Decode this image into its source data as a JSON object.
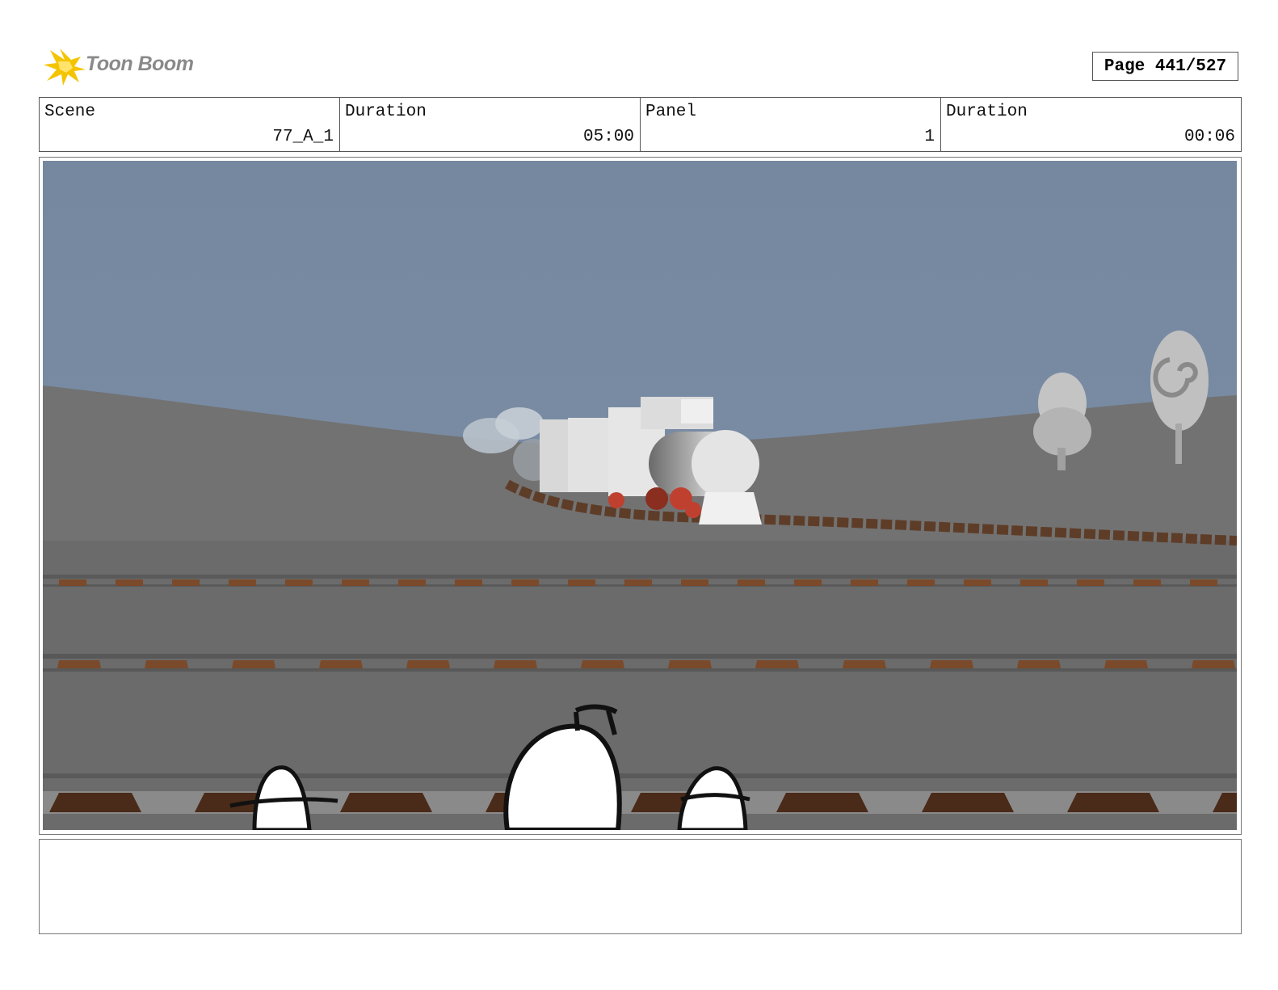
{
  "header": {
    "logo_text": "Toon Boom",
    "page_label": "Page 441/527"
  },
  "info": {
    "scene_label": "Scene",
    "scene_value": "77_A_1",
    "scene_duration_label": "Duration",
    "scene_duration_value": "05:00",
    "panel_label": "Panel",
    "panel_value": "1",
    "panel_duration_label": "Duration",
    "panel_duration_value": "00:06"
  },
  "panel": {
    "image_icon": "storyboard-frame-train-on-tracks"
  },
  "caption": {
    "text": ""
  },
  "colors": {
    "sky": "#7a8ea6",
    "ground": "#6e6e6e",
    "rail_tie": "#7a4a2a",
    "logo_star": "#f5c400"
  }
}
